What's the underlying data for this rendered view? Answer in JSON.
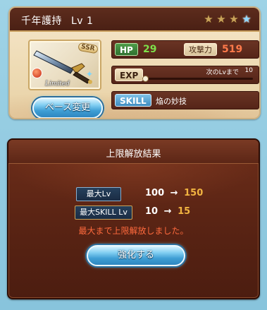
{
  "card": {
    "weapon_name": "千年護持",
    "level_label": "Lv",
    "level_value": "1",
    "stars": [
      "gold",
      "gold",
      "gold",
      "blue"
    ],
    "rarity_badge": "SSR",
    "limited_label": "Limited",
    "hp_label": "HP",
    "hp_value": "29",
    "attack_label": "攻撃力",
    "attack_value": "519",
    "exp_label": "EXP",
    "exp_next_label": "次のLvまで",
    "exp_next_value": "10",
    "exp_progress": 0.0,
    "skill_label": "SKILL",
    "skill_name": "焔の妙技",
    "base_change_button": "ベース変更"
  },
  "dialog": {
    "title": "上限解放結果",
    "max_level_label": "最大Lv",
    "max_level_old": "100",
    "max_level_new": "150",
    "max_skill_label": "最大SKILL Lv",
    "max_skill_old": "10",
    "max_skill_new": "15",
    "arrow": "→",
    "message": "最大まで上限解放しました。",
    "enhance_button": "強化する"
  },
  "colors": {
    "title_bar": "#4a2014",
    "hp_value": "#7ee04a",
    "attack_value": "#ff7a4a",
    "new_value": "#f2b441",
    "message": "#ff6a3d",
    "button_blue": "#3f9ed4"
  }
}
